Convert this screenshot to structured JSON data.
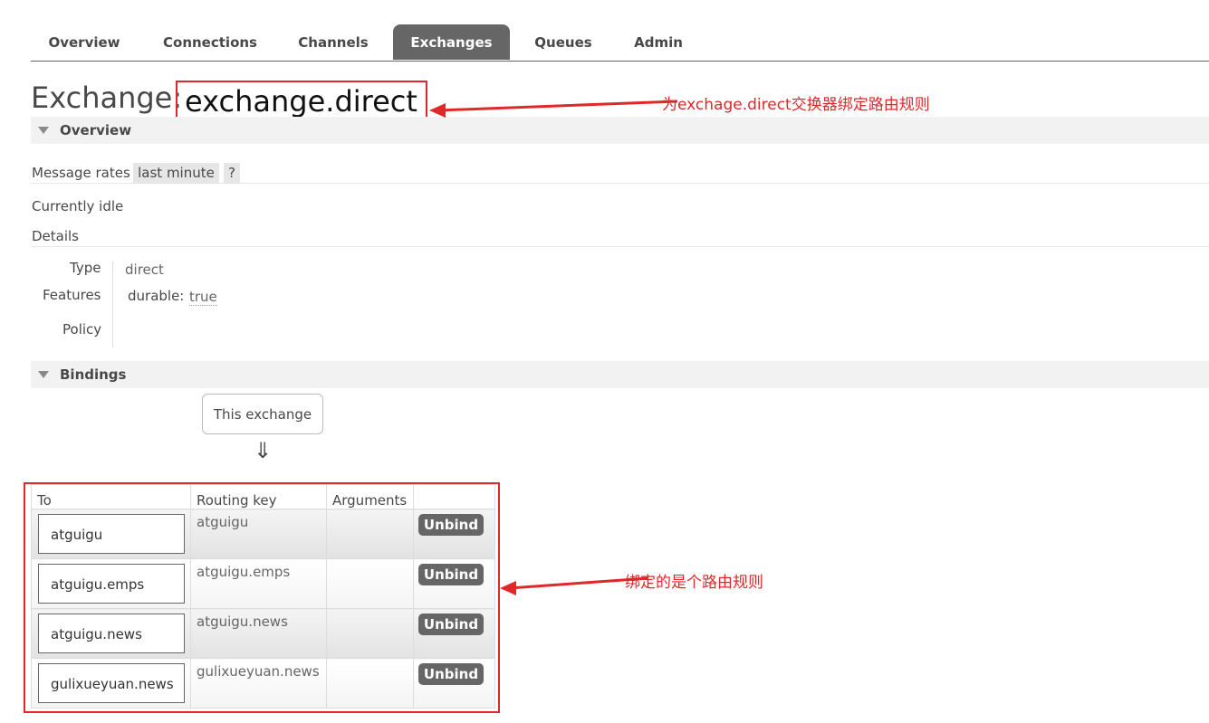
{
  "tabs": [
    "Overview",
    "Connections",
    "Channels",
    "Exchanges",
    "Queues",
    "Admin"
  ],
  "active_tab": "Exchanges",
  "title": {
    "prefix": "Exchange:",
    "name": "exchange.direct"
  },
  "overview": {
    "section_label": "Overview",
    "message_rates_label": "Message rates",
    "rate_period": "last minute",
    "help": "?",
    "idle": "Currently idle",
    "details_label": "Details",
    "type_label": "Type",
    "type_value": "direct",
    "features_label": "Features",
    "durable_label": "durable:",
    "durable_value": "true",
    "policy_label": "Policy"
  },
  "bindings": {
    "section_label": "Bindings",
    "source": "This exchange",
    "arrow": "⇓",
    "headers": [
      "To",
      "Routing key",
      "Arguments",
      ""
    ],
    "rows": [
      {
        "to": "atguigu",
        "routing_key": "atguigu",
        "arguments": "",
        "action": "Unbind"
      },
      {
        "to": "atguigu.emps",
        "routing_key": "atguigu.emps",
        "arguments": "",
        "action": "Unbind"
      },
      {
        "to": "atguigu.news",
        "routing_key": "atguigu.news",
        "arguments": "",
        "action": "Unbind"
      },
      {
        "to": "gulixueyuan.news",
        "routing_key": "gulixueyuan.news",
        "arguments": "",
        "action": "Unbind"
      }
    ]
  },
  "annotations": {
    "top": "为exchage.direct交换器绑定路由规则",
    "bindings": "绑定的是个路由规则",
    "color": "#e0282b"
  }
}
